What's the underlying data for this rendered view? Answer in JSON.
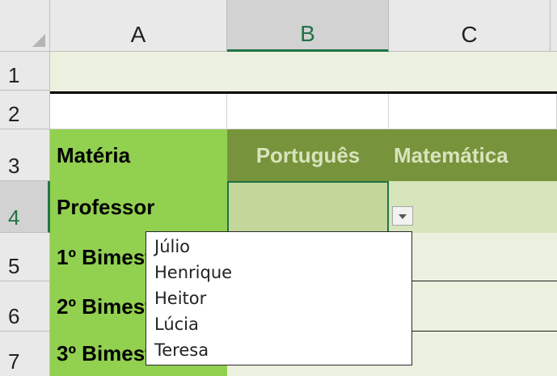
{
  "columns": [
    "A",
    "B",
    "C"
  ],
  "rows": [
    "1",
    "2",
    "3",
    "4",
    "5",
    "6",
    "7"
  ],
  "cells": {
    "A3": "Matéria",
    "B3": "Português",
    "C3": "Matemática",
    "A4": "Professor",
    "A5": "1º Bimestre",
    "A6": "2º Bimestre",
    "A7": "3º Bimestre"
  },
  "dropdown": {
    "options": [
      "Júlio",
      "Henrique",
      "Heitor",
      "Lúcia",
      "Teresa"
    ]
  },
  "colors": {
    "label_green": "#92d050",
    "header_green": "#77933c",
    "light_fill": "#ebf1de",
    "mid_fill": "#d8e4bc",
    "selection_accent": "#217346"
  }
}
